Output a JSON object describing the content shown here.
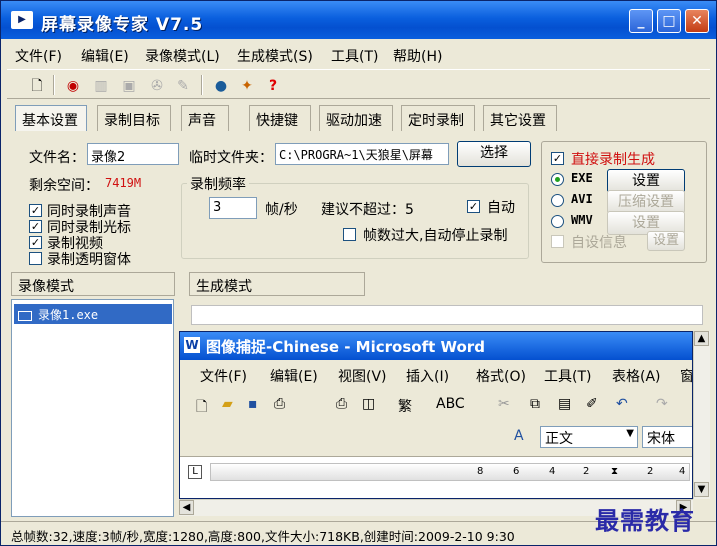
{
  "window": {
    "title": "屏幕录像专家  V7.5",
    "icon": "app-icon",
    "controls": [
      "_",
      "□",
      "✕"
    ]
  },
  "menu": [
    "文件(F)",
    "编辑(E)",
    "录像模式(L)",
    "生成模式(S)",
    "工具(T)",
    "帮助(H)"
  ],
  "toolbar": {
    "icons": [
      "new-icon",
      "record-icon",
      "pause-icon",
      "stop-icon",
      "camera-icon",
      "pen-icon",
      "globe-icon",
      "wizard-icon",
      "help-icon"
    ]
  },
  "tabs": [
    "基本设置",
    "录制目标",
    "声音",
    "快捷键",
    "驱动加速",
    "定时录制",
    "其它设置"
  ],
  "basic": {
    "filename_label": "文件名：",
    "filename_value": "录像2",
    "tempdir_label": "临时文件夹：",
    "tempdir_value": "C:\\PROGRA~1\\天狼星\\屏幕",
    "browse_button": "选择",
    "free_space_label": "剩余空间：",
    "free_space_value": "7419M",
    "options": [
      {
        "label": "同时录制声音",
        "checked": true
      },
      {
        "label": "同时录制光标",
        "checked": true
      },
      {
        "label": "录制视频",
        "checked": true
      },
      {
        "label": "录制透明窗体",
        "checked": false
      }
    ]
  },
  "frame_rate": {
    "group_title": "录制频率",
    "value": "3",
    "unit": "帧/秒",
    "suggest": "建议不超过：5",
    "auto_label": "自动",
    "auto_checked": true,
    "auto_stop_label": "帧数过大,自动停止录制",
    "auto_stop_checked": false
  },
  "generate": {
    "direct_label": "直接录制生成",
    "direct_checked": true,
    "formats": [
      {
        "label": "EXE",
        "selected": true,
        "button": "设置",
        "enabled": true
      },
      {
        "label": "AVI",
        "selected": false,
        "button": "压缩设置",
        "enabled": false
      },
      {
        "label": "WMV",
        "selected": false,
        "button": "设置",
        "enabled": false
      }
    ],
    "custom_info_label": "自设信息",
    "custom_info_button": "设置"
  },
  "panels": {
    "record_mode": "录像模式",
    "generate_mode": "生成模式"
  },
  "recordings": [
    "录像1.exe"
  ],
  "preview": {
    "word_title": "图像捕捉-Chinese - Microsoft Word",
    "word_menu": [
      "文件(F)",
      "编辑(E)",
      "视图(V)",
      "插入(I)",
      "格式(O)",
      "工具(T)",
      "表格(A)",
      "窗"
    ],
    "style_value": "正文",
    "font_value": "宋体",
    "ruler_ticks": [
      "8",
      "6",
      "4",
      "2",
      "",
      "2",
      "4"
    ]
  },
  "status": "总帧数:32,速度:3帧/秒,宽度:1280,高度:800,文件大小:718KB,创建时间:2009-2-10  9:30",
  "watermark": "最需教育",
  "colors": {
    "titlebar": "#0a5fde",
    "free_space": "#d01010",
    "direct_label": "#d01010",
    "selection": "#316ac5"
  }
}
